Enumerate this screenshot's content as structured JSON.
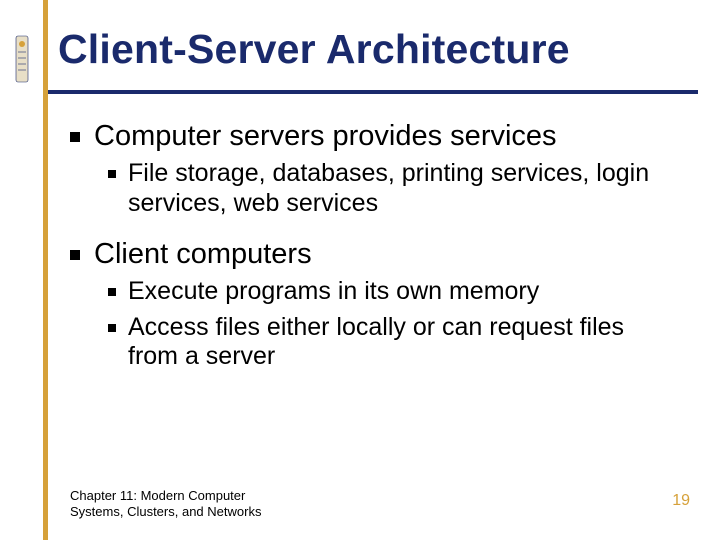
{
  "colors": {
    "accent_gold": "#d6a13a",
    "accent_navy": "#1a2a6c"
  },
  "title": "Client-Server Architecture",
  "bullets": {
    "b1": "Computer servers provides services",
    "b1_1": "File storage, databases, printing services, login services, web services",
    "b2": "Client computers",
    "b2_1": "Execute programs in its own memory",
    "b2_2": "Access files either locally or can request files from a server"
  },
  "footer": {
    "chapter_line1": "Chapter 11: Modern Computer",
    "chapter_line2": "Systems, Clusters, and Networks",
    "page_number": "19"
  }
}
